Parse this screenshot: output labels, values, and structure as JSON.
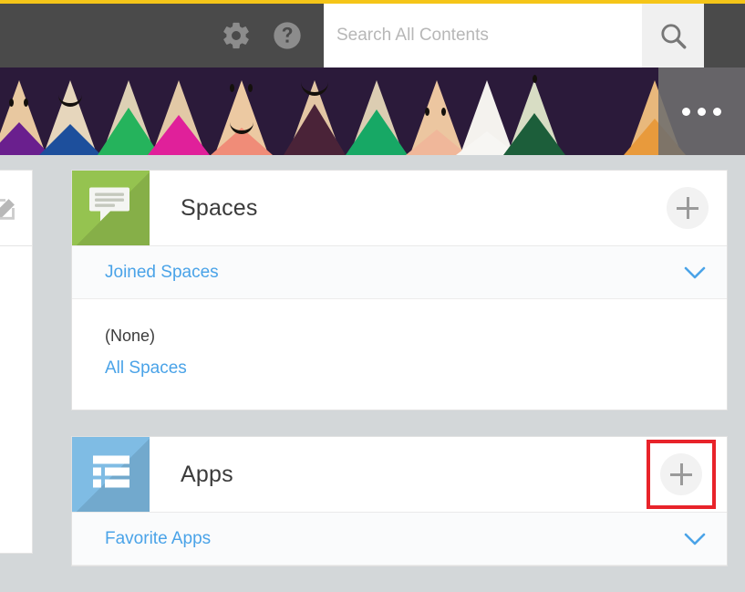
{
  "theme": {
    "accent_bar_color": "#f5c518",
    "header_bg": "#4a4a4a",
    "link_blue": "#4aa3e8",
    "spaces_tile_color": "#95c350",
    "apps_tile_color": "#7fbce4",
    "highlight_color": "#e8232a",
    "page_bg": "#d3d7d9"
  },
  "header": {
    "settings_icon": "gear-icon",
    "help_icon": "help-circle-icon",
    "search": {
      "placeholder": "Search All Contents",
      "value": "",
      "button_icon": "search-icon"
    }
  },
  "banner": {
    "image_description": "colored pencils with smiley faces",
    "more_menu_icon": "ellipsis-icon"
  },
  "left_rail": {
    "edit_icon": "edit-pencil-icon"
  },
  "cards": [
    {
      "id": "spaces",
      "title": "Spaces",
      "tile_icon": "speech-bubble-icon",
      "tile_color": "#95c350",
      "add_button_label": "+",
      "add_button_highlighted": false,
      "section": {
        "label": "Joined Spaces",
        "chevron_icon": "chevron-down-icon",
        "expanded": true
      },
      "body": {
        "empty_text": "(None)",
        "link_text": "All Spaces"
      }
    },
    {
      "id": "apps",
      "title": "Apps",
      "tile_icon": "list-icon",
      "tile_color": "#7fbce4",
      "add_button_label": "+",
      "add_button_highlighted": true,
      "section": {
        "label": "Favorite Apps",
        "chevron_icon": "chevron-down-icon",
        "expanded": true
      },
      "body": null
    }
  ]
}
